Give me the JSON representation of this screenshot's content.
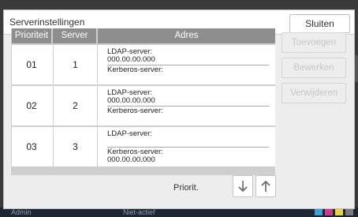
{
  "dialog": {
    "title": "Serverinstellingen",
    "close_label": "Sluiten"
  },
  "table": {
    "headers": [
      "Prioriteit",
      "Server",
      "Adres"
    ],
    "rows": [
      {
        "priority": "01",
        "server": "1",
        "addr_top_label": "LDAP-server:",
        "addr_top_value": "000.00.00.000",
        "addr_bot_label": "Kerberos-server:",
        "addr_bot_value": ""
      },
      {
        "priority": "02",
        "server": "2",
        "addr_top_label": "LDAP-server:",
        "addr_top_value": "000.00.00.000",
        "addr_bot_label": "Kerberos-server:",
        "addr_bot_value": ""
      },
      {
        "priority": "03",
        "server": "3",
        "addr_top_label": "LDAP-server:",
        "addr_top_value": "",
        "addr_bot_label": "Kerberos-server:",
        "addr_bot_value": "000.00.00.000"
      }
    ]
  },
  "side_buttons": {
    "add": "Toevoegen",
    "edit": "Bewerken",
    "delete": "Verwijderen"
  },
  "priority_control": {
    "label": "Priorit.",
    "down_icon": "arrow-down-icon",
    "up_icon": "arrow-up-icon"
  },
  "status_bar": {
    "user": "Admin",
    "state": "Niet-actief",
    "ink_colors": [
      "#3aa0d8",
      "#d03a8a",
      "#e8d23a",
      "#7a7a7a"
    ]
  },
  "colors": {
    "header_bg": "#8e8e8e",
    "disabled_text": "#c6c6c6"
  }
}
